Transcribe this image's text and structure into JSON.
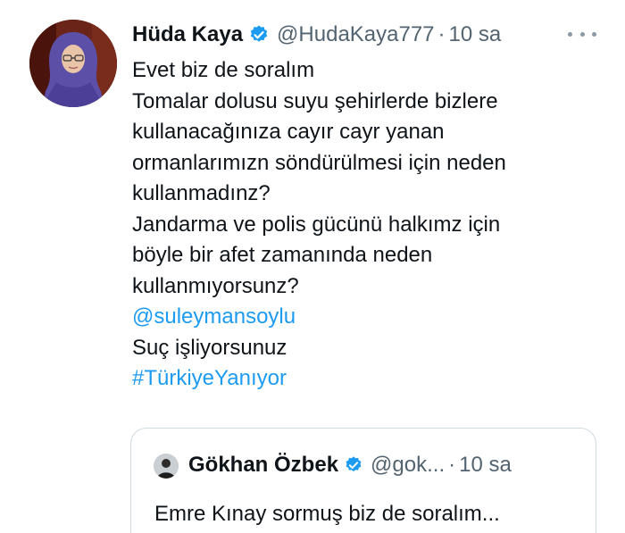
{
  "tweet": {
    "author": {
      "name": "Hüda Kaya",
      "handle": "@HudaKaya777",
      "time": "10 sa",
      "verified": true,
      "avatar_icon": "profile-photo"
    },
    "separator": "·",
    "more_icon": "more-dots-icon",
    "lines": [
      "Evet biz de soralım",
      "Tomalar dolusu suyu şehirlerde bizlere",
      "kullanacağınıza cayır cayr yanan",
      "ormanlarımızn söndürülmesi için neden",
      "kullanmadınz?",
      "Jandarma ve polis gücünü halkımz için",
      "böyle bir afet zamanında neden",
      "kullanmıyorsunz?"
    ],
    "mention": "@suleymansoylu",
    "after_mention": "Suç işliyorsunuz",
    "hashtag": "#TürkiyeYanıyor"
  },
  "quote": {
    "author": {
      "name": "Gökhan Özbek",
      "handle": "@gok...",
      "time": "10 sa",
      "verified": true,
      "avatar_icon": "profile-photo"
    },
    "separator": "·",
    "text": "Emre Kınay sormuş biz de soralım..."
  },
  "colors": {
    "link": "#1d9bf0",
    "verified": "#1d9bf0",
    "secondary_text": "#536471",
    "border": "#cfd9de"
  }
}
